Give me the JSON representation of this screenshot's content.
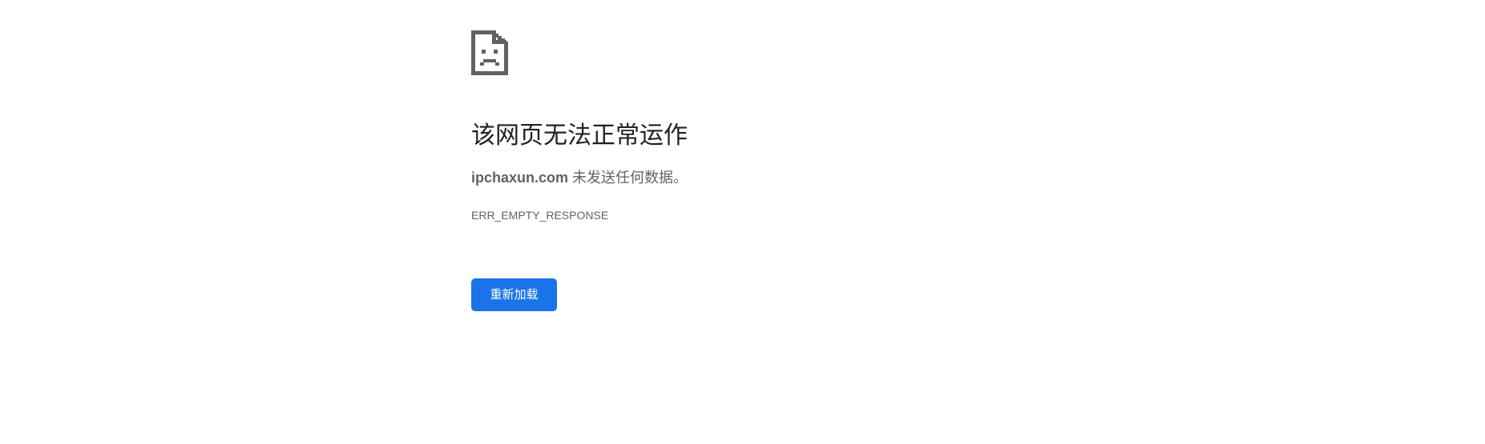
{
  "error_page": {
    "icon": "sad-page-icon",
    "title": "该网页无法正常运作",
    "host": "ipchaxun.com",
    "message_suffix": " 未发送任何数据。",
    "error_code": "ERR_EMPTY_RESPONSE",
    "reload_label": "重新加载"
  },
  "colors": {
    "background": "#ffffff",
    "title_text": "#202124",
    "secondary_text": "#5f6368",
    "button_bg": "#1a73e8",
    "button_text": "#ffffff",
    "icon_gray": "#5f6368"
  }
}
